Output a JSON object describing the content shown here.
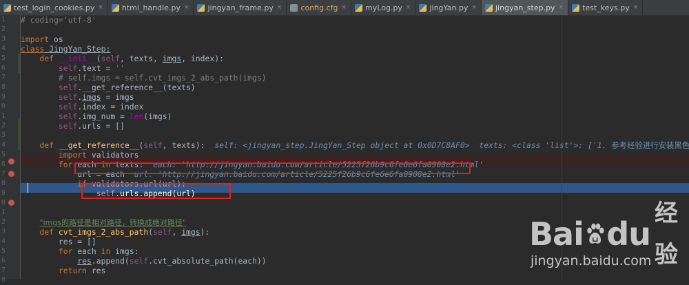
{
  "tabs": [
    {
      "label": "test_login_cookies.py",
      "icon": "python-file-icon"
    },
    {
      "label": "html_handle.py",
      "icon": "python-file-icon"
    },
    {
      "label": "jingyan_frame.py",
      "icon": "python-file-icon"
    },
    {
      "label": "config.cfg",
      "icon": "config-file-icon"
    },
    {
      "label": "myLog.py",
      "icon": "python-file-icon"
    },
    {
      "label": "jingYan.py",
      "icon": "python-file-icon"
    },
    {
      "label": "jingyan_step.py",
      "icon": "python-file-icon",
      "active": true
    },
    {
      "label": "test_keys.py",
      "icon": "python-file-icon"
    }
  ],
  "tab_close_glyph": "×",
  "line_numbers": [
    "1",
    "2",
    "3",
    "4",
    "5",
    "6",
    "7",
    "8",
    "9",
    "0",
    "1",
    "2",
    "3",
    "4",
    "5",
    "6",
    "7",
    "8",
    "9",
    "0",
    "1",
    "2",
    "3",
    "4",
    "5",
    "6",
    "7",
    "8"
  ],
  "code": {
    "l1": "# coding='utf-8'",
    "l3_kw": "import",
    "l3_mod": " os",
    "l4_kw": "class",
    "l4_name": " JingYan_Step",
    "l4_end": ":",
    "l5_kw": "def",
    "l5_fn": "__init__",
    "l5_p1": "(",
    "l5_self": "self",
    "l5_p2": ", texts, ",
    "l5_imgs": "imgs",
    "l5_p3": ", index):",
    "l6_self": "self",
    "l6_rest": ".text = ",
    "l6_str": "''",
    "l7": "# self.imgs = self.cvt_imgs_2_abs_path(imgs)",
    "l8_self": "self",
    "l8_rest": ".__get_reference__(texts)",
    "l9_self": "self",
    "l9_a": ".",
    "l9_b": "imgs",
    "l9_c": " = imgs",
    "l10_self": "self",
    "l10_rest": ".index = index",
    "l11_self": "self",
    "l11_a": ".img_num = ",
    "l11_b": "len",
    "l11_c": "(imgs)",
    "l12_self": "self",
    "l12_rest": ".urls = []",
    "l14_kw": "def",
    "l14_fn": "__get_reference__",
    "l14_p1": "(",
    "l14_self": "self",
    "l14_p2": ", texts):",
    "l14_dbg": "self: <jingyan_step.JingYan_Step object at 0x0D7C8AF0>  texts: <class 'list'>: ['1. ",
    "l14_zh": "参考经验进行安装黑色主题",
    "l14_end": "', ",
    "l15_kw": "import",
    "l15_mod": " validators",
    "l16_kw1": "for",
    "l16_var": " each ",
    "l16_kw2": "in",
    "l16_rest": " texts:",
    "l16_dbg": "each: 'http://jingyan.baidu.com/article/5225f26b9c6fe6e6fa0908e2.html'",
    "l17_code": "url = each",
    "l17_dbg": "url: 'http://jingyan.baidu.com/article/5225f26b9c6fe6e6fa0908e2.html'",
    "l18_kw": "if",
    "l18_rest": " validators.url(url):",
    "l19_self": "self",
    "l19_rest": ".urls.append(url)",
    "l22_str": "\"imgs的路径是相对路径，转换成绝对路径\"",
    "l23_kw": "def",
    "l23_fn": "cvt_imgs_2_abs_path",
    "l23_p1": "(",
    "l23_self": "self",
    "l23_p2": ", ",
    "l23_imgs": "imgs",
    "l23_p3": "):",
    "l24": "res = []",
    "l25_kw1": "for",
    "l25_var": " each ",
    "l25_kw2": "in",
    "l25_rest": " imgs:",
    "l26_a": "res",
    "l26_b": ".append(",
    "l26_self": "self",
    "l26_c": ".cvt_absolute_path(each))",
    "l27_kw": "return",
    "l27_rest": " res"
  },
  "watermark": {
    "brand_left": "Bai",
    "brand_right": "du",
    "brand_zh": "经验",
    "url": "jingyan.baidu.com"
  },
  "colors": {
    "background": "#2b2b2b",
    "keyword": "#cc7832",
    "selection": "#2d5889",
    "breakpoint": "#c75450",
    "annotation": "#e81e1e"
  }
}
